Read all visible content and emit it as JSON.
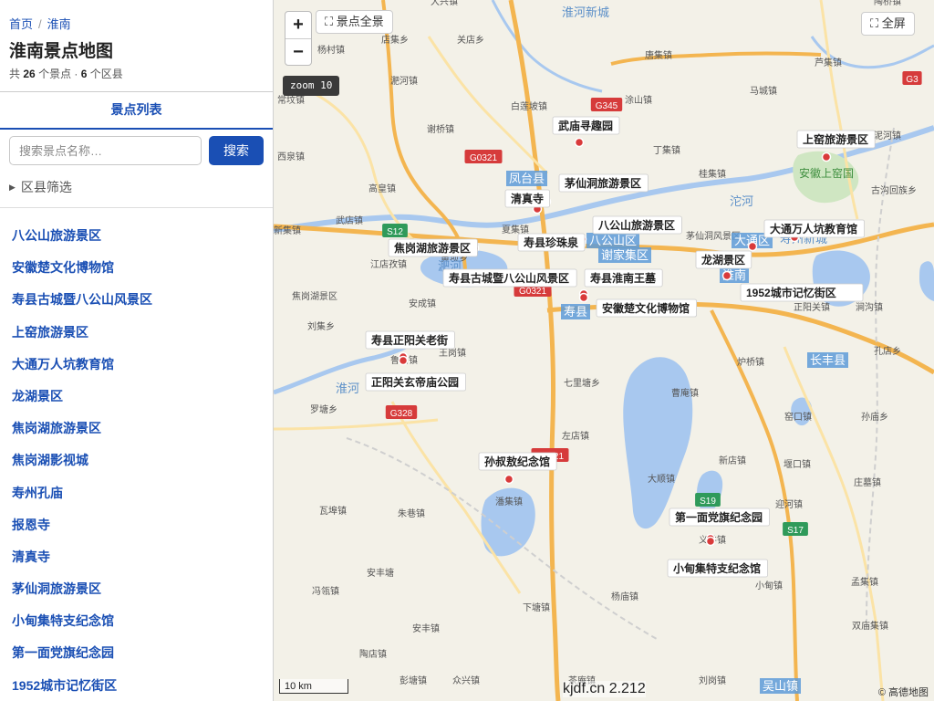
{
  "breadcrumb": {
    "home": "首页",
    "separator": "/",
    "current": "淮南"
  },
  "page": {
    "title": "淮南景点地图"
  },
  "summary": {
    "prefix": "共",
    "spot_count": "26",
    "spot_unit": "个景点 ·",
    "district_count": "6",
    "district_unit": "个区县"
  },
  "tabs": {
    "active": "景点列表"
  },
  "search": {
    "placeholder": "搜索景点名称…",
    "button": "搜索"
  },
  "filter": {
    "label": "区县筛选",
    "icon": "triangle-right-icon"
  },
  "spots": [
    "八公山旅游景区",
    "安徽楚文化博物馆",
    "寿县古城暨八公山风景区",
    "上窑旅游景区",
    "大通万人坑教育馆",
    "龙湖景区",
    "焦岗湖旅游景区",
    "焦岗湖影视城",
    "寿州孔庙",
    "报恩寺",
    "清真寺",
    "茅仙洞旅游景区",
    "小甸集特支纪念馆",
    "第一面党旗纪念园",
    "1952城市记忆街区"
  ],
  "map": {
    "zoom_in": "+",
    "zoom_out": "−",
    "fit_all": "景点全景",
    "fullscreen": "全屏",
    "zoom_label": "zoom 10",
    "scale": "10 km",
    "watermark": "kjdf.cn 2.212",
    "attribution": "© 高德地图",
    "colors": {
      "marker": "#d93a3a",
      "water": "#a8c8ef",
      "highway": "#f3b550",
      "road": "#fbe3a6",
      "label_badge": "#5d9bd8"
    },
    "poi_labels": [
      "武庙寻趣园",
      "茅仙洞旅游景区",
      "清真寺",
      "八公山旅游景区",
      "焦岗湖旅游景区",
      "寿县珍珠泉",
      "寿县古城暨八公山风景区",
      "寿县淮南王墓",
      "安徽楚文化博物馆",
      "上窑旅游景区",
      "大通万人坑教育馆",
      "龙湖景区",
      "1952城市记忆街区",
      "寿县正阳关老街",
      "正阳关玄帝庙公园",
      "孙叔敖纪念馆",
      "第一面党旗纪念园",
      "小甸集特支纪念馆"
    ],
    "place_labels": [
      "杨村镇",
      "店集乡",
      "关店乡",
      "大兴镇",
      "淝河镇",
      "唐集镇",
      "白莲坡镇",
      "涂山镇",
      "马城镇",
      "陶桥镇",
      "芦集镇",
      "泥河镇",
      "常坟镇",
      "西泉镇",
      "谢桥镇",
      "丁集镇",
      "桂集镇",
      "古沟回族乡",
      "高皇镇",
      "武店镇",
      "新集镇",
      "江店孜镇",
      "夏集镇",
      "黄坝乡",
      "茅仙洞风景区",
      "焦岗湖景区",
      "安成镇",
      "刘集乡",
      "鲁口镇",
      "王岗镇",
      "正阳关镇",
      "涧沟镇",
      "孔店乡",
      "炉桥镇",
      "七里塘乡",
      "曹庵镇",
      "窑口镇",
      "孙庙乡",
      "罗塘乡",
      "左店镇",
      "新店镇",
      "堰口镇",
      "大顺镇",
      "庄墓镇",
      "瓦埠镇",
      "朱巷镇",
      "潘集镇",
      "迎河镇",
      "安丰塘",
      "义井镇",
      "冯瓴镇",
      "小甸镇",
      "孟集镇",
      "杨庙镇",
      "下塘镇",
      "双庙集镇",
      "安丰镇",
      "陶店镇",
      "彭塘镇",
      "众兴镇",
      "茶庵镇",
      "刘岗镇",
      "吴山镇",
      "谢家集区",
      "寿县",
      "淮南",
      "长丰县",
      "大通区",
      "八公山区",
      "凤台县",
      "安徽上窑国家森林公园",
      "淮河",
      "淝河",
      "沱河",
      "淮河新城",
      "寿州新城"
    ],
    "road_labels": [
      "G345",
      "G0321",
      "S12",
      "G328",
      "S19",
      "S17",
      "G3"
    ]
  }
}
